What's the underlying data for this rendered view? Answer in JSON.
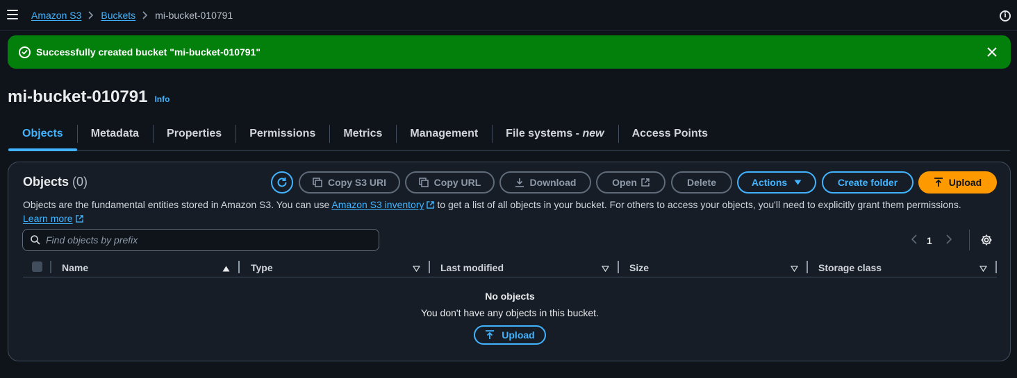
{
  "breadcrumb": {
    "items": [
      {
        "label": "Amazon S3"
      },
      {
        "label": "Buckets"
      },
      {
        "label": "mi-bucket-010791"
      }
    ]
  },
  "flash": {
    "message": "Successfully created bucket \"mi-bucket-010791\""
  },
  "page": {
    "title": "mi-bucket-010791",
    "info_label": "Info"
  },
  "tabs": [
    {
      "label": "Objects",
      "active": true
    },
    {
      "label": "Metadata"
    },
    {
      "label": "Properties"
    },
    {
      "label": "Permissions"
    },
    {
      "label": "Metrics"
    },
    {
      "label": "Management"
    },
    {
      "label": "File systems - ",
      "suffix": "new"
    },
    {
      "label": "Access Points"
    }
  ],
  "objects_panel": {
    "title": "Objects",
    "count": "(0)",
    "buttons": {
      "copy_s3_uri": "Copy S3 URI",
      "copy_url": "Copy URL",
      "download": "Download",
      "open": "Open",
      "delete": "Delete",
      "actions": "Actions",
      "create_folder": "Create folder",
      "upload": "Upload"
    },
    "description": {
      "part1": "Objects are the fundamental entities stored in Amazon S3. You can use ",
      "link1": "Amazon S3 inventory",
      "part2": " to get a list of all objects in your bucket. For others to access your objects, you'll need to explicitly grant them permissions.",
      "link2": "Learn more"
    },
    "search": {
      "placeholder": "Find objects by prefix"
    },
    "pagination": {
      "current_page": "1"
    },
    "table": {
      "columns": [
        "Name",
        "Type",
        "Last modified",
        "Size",
        "Storage class"
      ]
    },
    "empty_state": {
      "title": "No objects",
      "subtitle": "You don't have any objects in this bucket.",
      "upload_label": "Upload"
    }
  },
  "colors": {
    "background": "#0f141a",
    "accent": "#42b4ff",
    "success": "#037f0c",
    "primary_button": "#ff9900"
  }
}
